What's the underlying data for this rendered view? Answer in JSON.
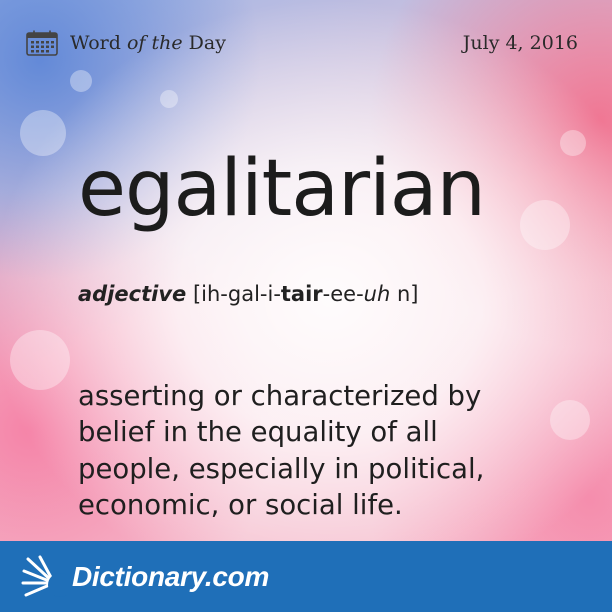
{
  "header": {
    "label_word": "Word",
    "label_of_the": "of the",
    "label_day": "Day",
    "date": "July 4, 2016"
  },
  "entry": {
    "word": "egalitarian",
    "part_of_speech": "adjective",
    "pron_prefix": "[ih-gal-i-",
    "pron_stress": "tair",
    "pron_mid": "-ee-",
    "pron_schwa": "uh",
    "pron_suffix": " n]",
    "definition_lines": [
      "asserting or characterized by",
      "belief in the equality of all",
      "people, especially in political,",
      "economic, or social life."
    ]
  },
  "footer": {
    "logo_text": "Dictionary.com"
  },
  "icons": [
    "calendar-icon",
    "sunburst-icon"
  ],
  "colors": {
    "footer_bg": "#1f6fb8",
    "text": "#1f1f1f"
  }
}
